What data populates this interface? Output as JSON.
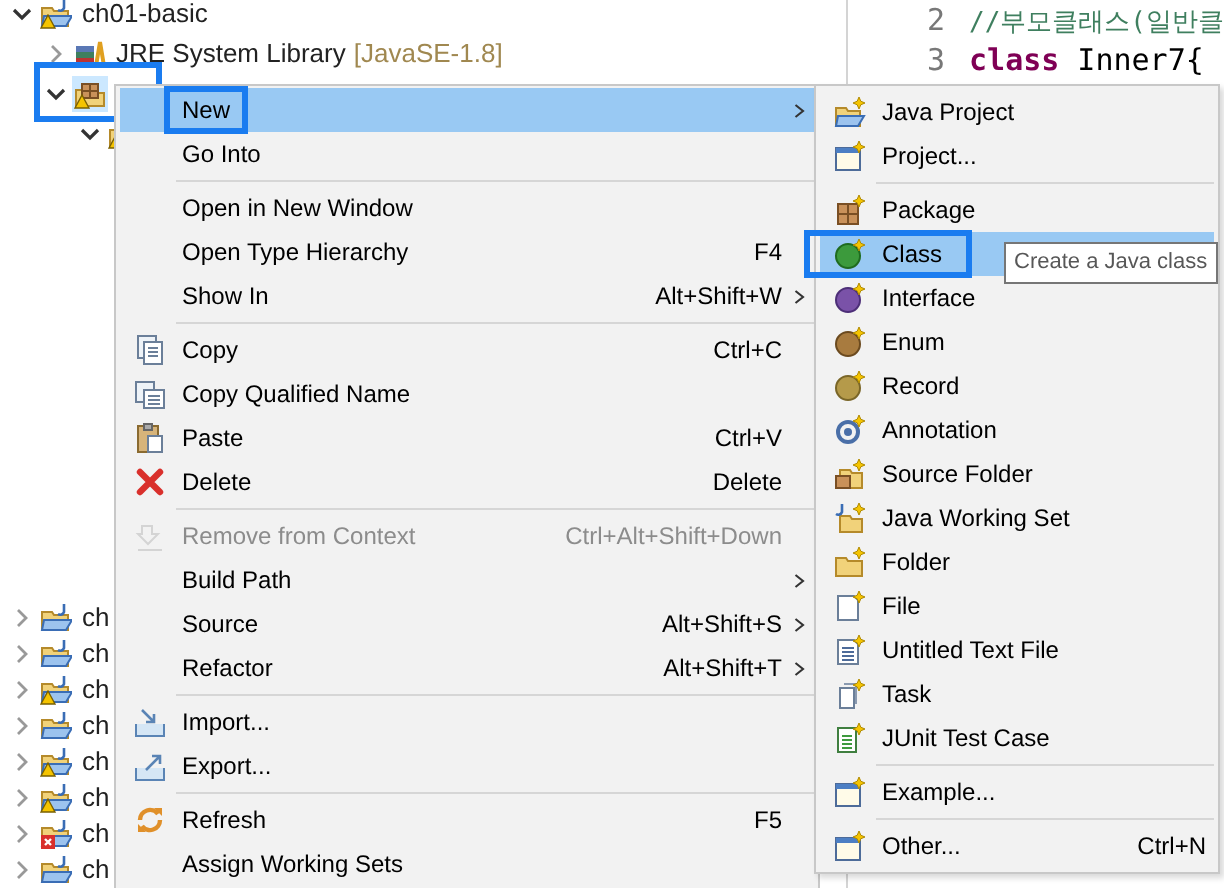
{
  "explorer": {
    "tree": [
      {
        "label": "ch01-basic",
        "kind": "project",
        "warning": true,
        "error": false,
        "expanded": true,
        "selected": false,
        "outlined": false,
        "children": [
          {
            "label": "JRE System Library",
            "decoration": "[JavaSE-1.8]",
            "kind": "library",
            "warning": false,
            "error": false,
            "expanded": false,
            "selected": false,
            "outlined": false
          },
          {
            "kind": "package",
            "warning": true,
            "error": false,
            "expanded": true,
            "selected": true,
            "outlined": true,
            "children": [
              {
                "kind": "package",
                "warning": true,
                "error": false,
                "expanded": true,
                "selected": false,
                "outlined": false
              }
            ]
          }
        ]
      },
      {
        "label": "ch",
        "kind": "project",
        "warning": false,
        "error": false,
        "expanded": false,
        "selected": false,
        "outlined": false
      },
      {
        "label": "ch",
        "kind": "project",
        "warning": false,
        "error": false,
        "expanded": false,
        "selected": false,
        "outlined": false
      },
      {
        "label": "ch",
        "kind": "project",
        "warning": true,
        "error": false,
        "expanded": false,
        "selected": false,
        "outlined": false
      },
      {
        "label": "ch",
        "kind": "project",
        "warning": false,
        "error": false,
        "expanded": false,
        "selected": false,
        "outlined": false
      },
      {
        "label": "ch",
        "kind": "project",
        "warning": true,
        "error": false,
        "expanded": false,
        "selected": false,
        "outlined": false
      },
      {
        "label": "ch",
        "kind": "project",
        "warning": true,
        "error": false,
        "expanded": false,
        "selected": false,
        "outlined": false
      },
      {
        "label": "ch",
        "kind": "project",
        "warning": false,
        "error": true,
        "expanded": false,
        "selected": false,
        "outlined": false
      },
      {
        "label": "ch",
        "kind": "project",
        "warning": false,
        "error": false,
        "expanded": false,
        "selected": false,
        "outlined": false
      }
    ]
  },
  "editor": {
    "lines": [
      {
        "number": "2",
        "tokens": [
          {
            "kind": "comment",
            "text": "//부모클래스(일반클"
          }
        ]
      },
      {
        "number": "3",
        "tokens": [
          {
            "kind": "keyword",
            "text": "class"
          },
          {
            "kind": "plain",
            "text": "Inner7{"
          }
        ]
      }
    ]
  },
  "context_menu": {
    "items": [
      {
        "kind": "item",
        "label": "New",
        "submenu": true,
        "selected": true,
        "outlined": true,
        "disabled": false
      },
      {
        "kind": "item",
        "label": "Go Into",
        "submenu": false,
        "selected": false,
        "outlined": false,
        "disabled": false
      },
      {
        "kind": "separator"
      },
      {
        "kind": "item",
        "label": "Open in New Window",
        "submenu": false,
        "selected": false,
        "outlined": false,
        "disabled": false
      },
      {
        "kind": "item",
        "label": "Open Type Hierarchy",
        "shortcut": "F4",
        "submenu": false,
        "selected": false,
        "outlined": false,
        "disabled": false
      },
      {
        "kind": "item",
        "label": "Show In",
        "shortcut": "Alt+Shift+W",
        "submenu": true,
        "selected": false,
        "outlined": false,
        "disabled": false
      },
      {
        "kind": "separator"
      },
      {
        "kind": "item",
        "label": "Copy",
        "shortcut": "Ctrl+C",
        "submenu": false,
        "selected": false,
        "outlined": false,
        "disabled": false
      },
      {
        "kind": "item",
        "label": "Copy Qualified Name",
        "submenu": false,
        "selected": false,
        "outlined": false,
        "disabled": false
      },
      {
        "kind": "item",
        "label": "Paste",
        "shortcut": "Ctrl+V",
        "submenu": false,
        "selected": false,
        "outlined": false,
        "disabled": false
      },
      {
        "kind": "item",
        "label": "Delete",
        "shortcut": "Delete",
        "submenu": false,
        "selected": false,
        "outlined": false,
        "disabled": false
      },
      {
        "kind": "separator"
      },
      {
        "kind": "item",
        "label": "Remove from Context",
        "shortcut": "Ctrl+Alt+Shift+Down",
        "submenu": false,
        "selected": false,
        "outlined": false,
        "disabled": true
      },
      {
        "kind": "item",
        "label": "Build Path",
        "submenu": true,
        "selected": false,
        "outlined": false,
        "disabled": false
      },
      {
        "kind": "item",
        "label": "Source",
        "shortcut": "Alt+Shift+S",
        "submenu": true,
        "selected": false,
        "outlined": false,
        "disabled": false
      },
      {
        "kind": "item",
        "label": "Refactor",
        "shortcut": "Alt+Shift+T",
        "submenu": true,
        "selected": false,
        "outlined": false,
        "disabled": false
      },
      {
        "kind": "separator"
      },
      {
        "kind": "item",
        "label": "Import...",
        "submenu": false,
        "selected": false,
        "outlined": false,
        "disabled": false
      },
      {
        "kind": "item",
        "label": "Export...",
        "submenu": false,
        "selected": false,
        "outlined": false,
        "disabled": false
      },
      {
        "kind": "separator"
      },
      {
        "kind": "item",
        "label": "Refresh",
        "shortcut": "F5",
        "submenu": false,
        "selected": false,
        "outlined": false,
        "disabled": false
      },
      {
        "kind": "item",
        "label": "Assign Working Sets",
        "submenu": false,
        "selected": false,
        "outlined": false,
        "disabled": false
      }
    ]
  },
  "submenu": {
    "items": [
      {
        "kind": "item",
        "label": "Java Project",
        "selected": false,
        "outlined": false
      },
      {
        "kind": "item",
        "label": "Project...",
        "selected": false,
        "outlined": false
      },
      {
        "kind": "separator"
      },
      {
        "kind": "item",
        "label": "Package",
        "selected": false,
        "outlined": false
      },
      {
        "kind": "item",
        "label": "Class",
        "selected": true,
        "outlined": true,
        "tooltip": "Create a Java class"
      },
      {
        "kind": "item",
        "label": "Interface",
        "selected": false,
        "outlined": false
      },
      {
        "kind": "item",
        "label": "Enum",
        "selected": false,
        "outlined": false
      },
      {
        "kind": "item",
        "label": "Record",
        "selected": false,
        "outlined": false
      },
      {
        "kind": "item",
        "label": "Annotation",
        "selected": false,
        "outlined": false
      },
      {
        "kind": "item",
        "label": "Source Folder",
        "selected": false,
        "outlined": false
      },
      {
        "kind": "item",
        "label": "Java Working Set",
        "selected": false,
        "outlined": false
      },
      {
        "kind": "item",
        "label": "Folder",
        "selected": false,
        "outlined": false
      },
      {
        "kind": "item",
        "label": "File",
        "selected": false,
        "outlined": false
      },
      {
        "kind": "item",
        "label": "Untitled Text File",
        "selected": false,
        "outlined": false
      },
      {
        "kind": "item",
        "label": "Task",
        "selected": false,
        "outlined": false
      },
      {
        "kind": "item",
        "label": "JUnit Test Case",
        "selected": false,
        "outlined": false
      },
      {
        "kind": "separator"
      },
      {
        "kind": "item",
        "label": "Example...",
        "selected": false,
        "outlined": false
      },
      {
        "kind": "separator"
      },
      {
        "kind": "item",
        "label": "Other...",
        "shortcut": "Ctrl+N",
        "selected": false,
        "outlined": false
      }
    ]
  }
}
